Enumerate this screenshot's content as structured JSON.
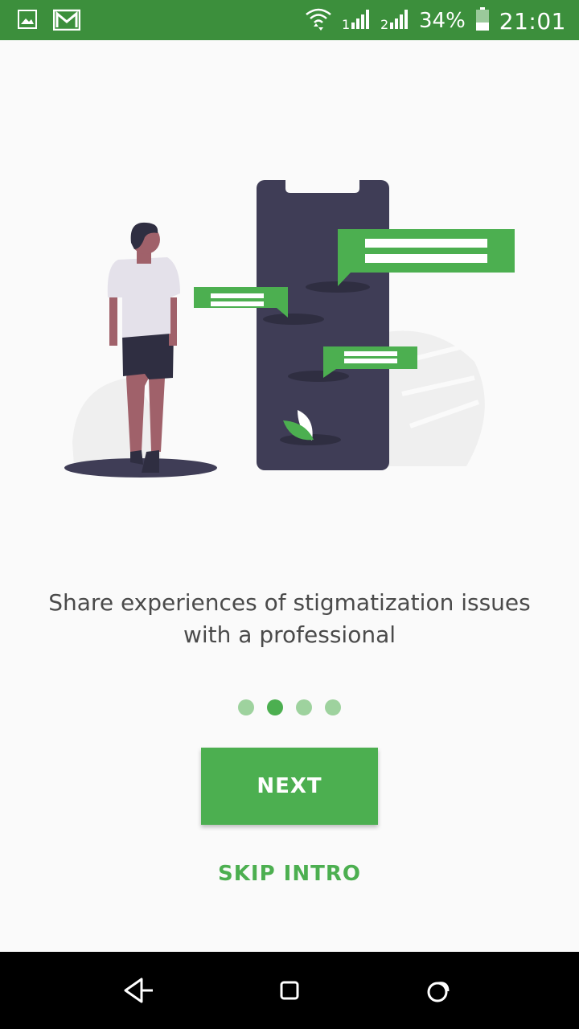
{
  "status_bar": {
    "battery": "34%",
    "time": "21:01",
    "icons": [
      "image-icon",
      "gmail-icon",
      "wifi-icon",
      "signal-sim1-icon",
      "signal-sim2-icon",
      "battery-icon"
    ]
  },
  "onboarding": {
    "caption_line1": "Share experiences of stigmatization issues",
    "caption_line2": "with a professional",
    "page_count": 4,
    "current_page": 2,
    "next_label": "NEXT",
    "skip_label": "SKIP INTRO"
  },
  "nav_bar": {
    "icons": [
      "back-icon",
      "home-icon",
      "recents-icon"
    ]
  },
  "colors": {
    "status_bar": "#3c8f3c",
    "accent": "#4caf50",
    "dot_inactive": "#9ed29e",
    "phone": "#3f3d56",
    "text": "#4a4a4a"
  }
}
